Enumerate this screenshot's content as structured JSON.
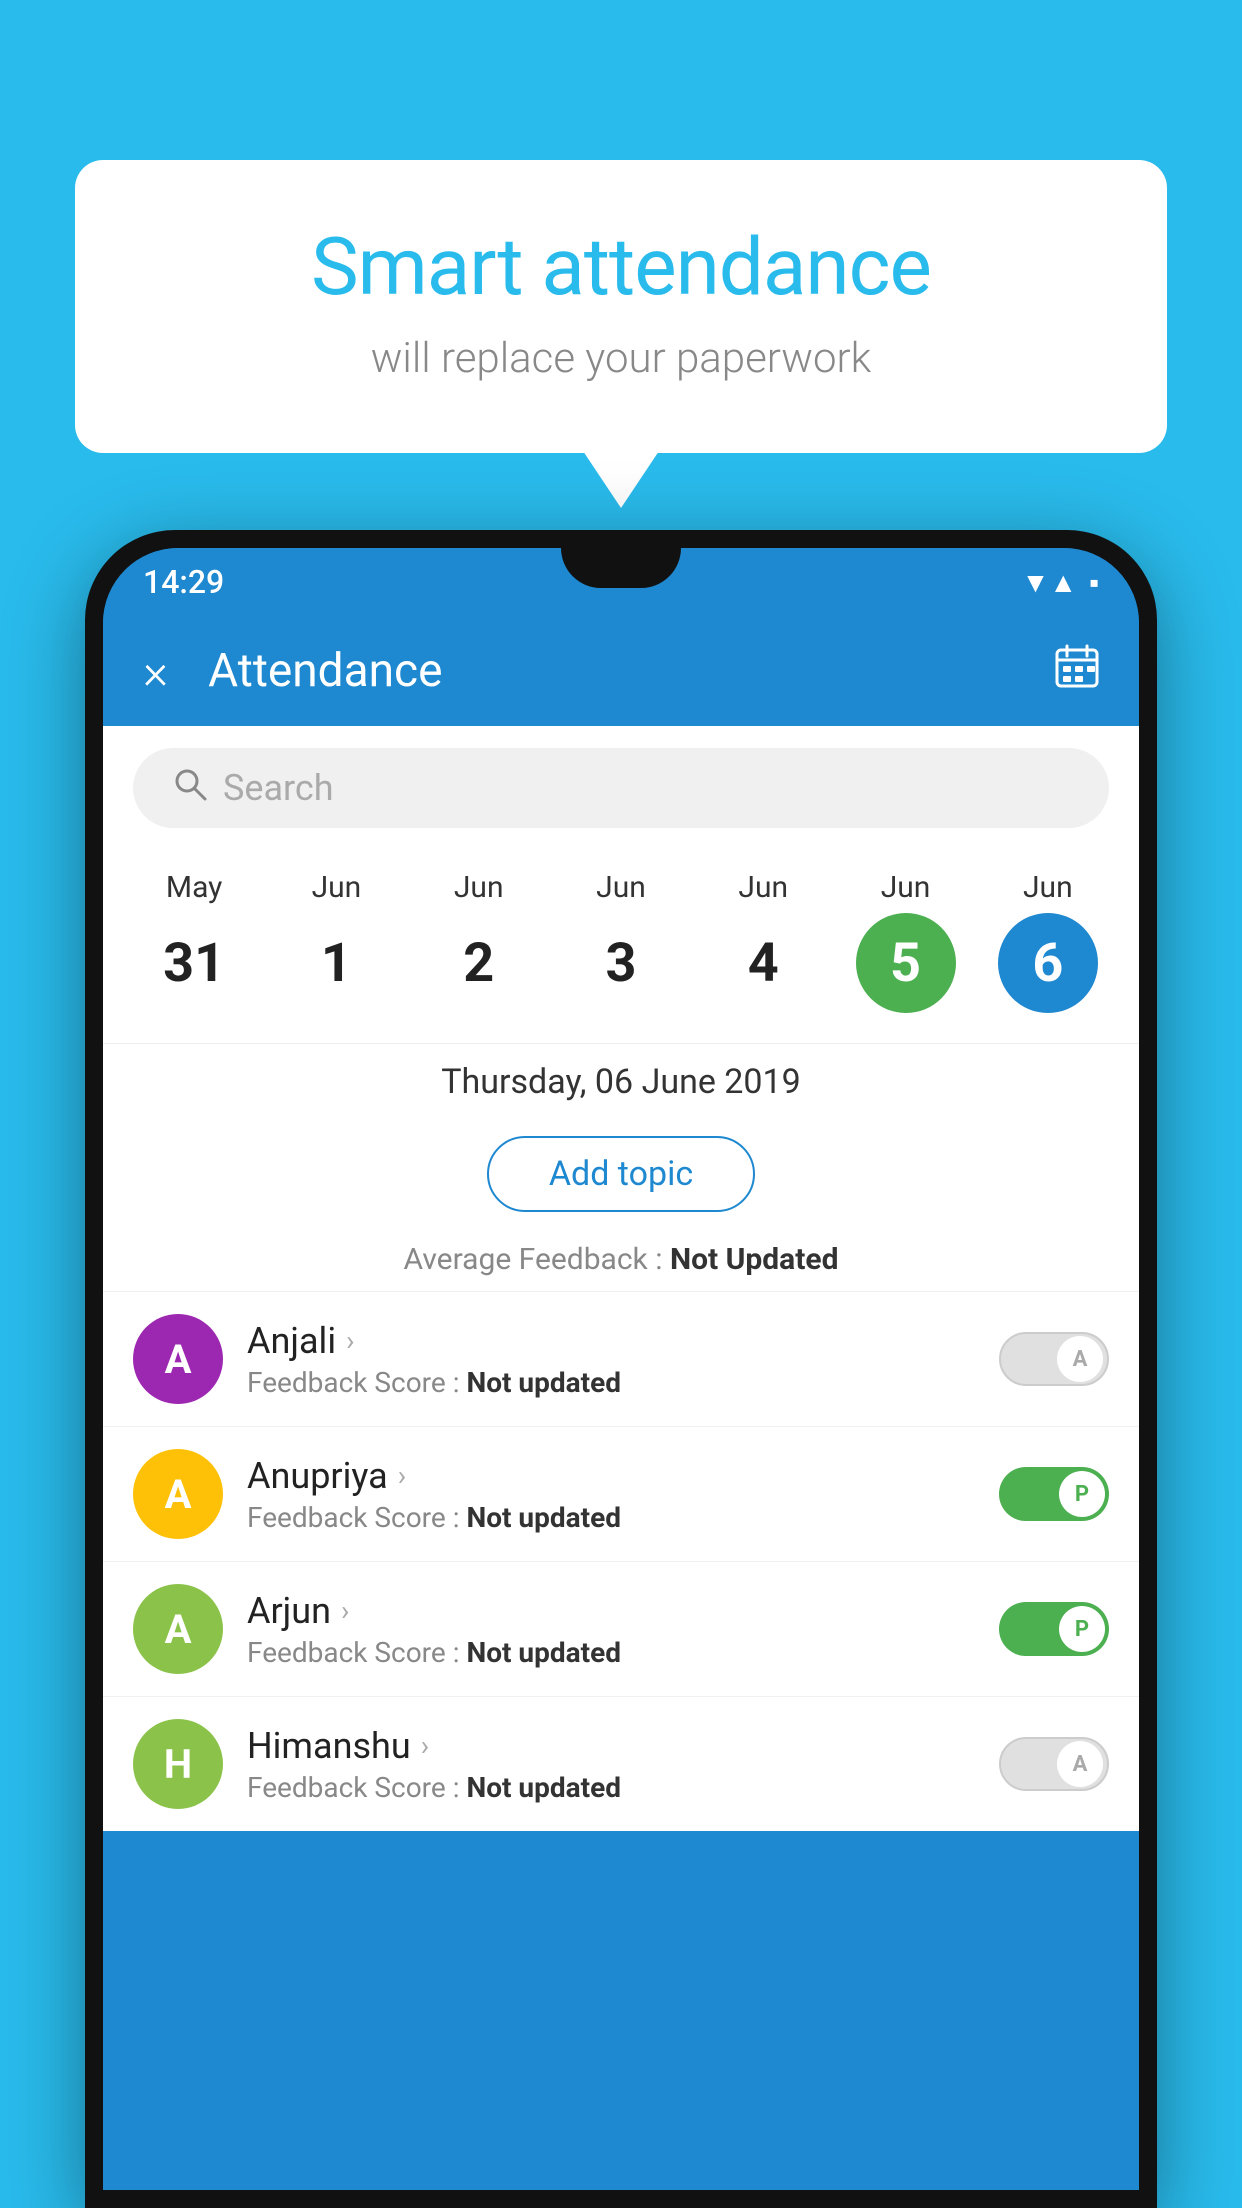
{
  "background_color": "#29BBEC",
  "speech_bubble": {
    "title": "Smart attendance",
    "subtitle": "will replace your paperwork"
  },
  "status_bar": {
    "time": "14:29",
    "icons": [
      "wifi",
      "signal",
      "battery"
    ]
  },
  "app_bar": {
    "title": "Attendance",
    "close_label": "×",
    "calendar_icon": "calendar"
  },
  "search": {
    "placeholder": "Search"
  },
  "calendar": {
    "dates": [
      {
        "month": "May",
        "day": "31",
        "active": false
      },
      {
        "month": "Jun",
        "day": "1",
        "active": false
      },
      {
        "month": "Jun",
        "day": "2",
        "active": false
      },
      {
        "month": "Jun",
        "day": "3",
        "active": false
      },
      {
        "month": "Jun",
        "day": "4",
        "active": false
      },
      {
        "month": "Jun",
        "day": "5",
        "active": "green"
      },
      {
        "month": "Jun",
        "day": "6",
        "active": "blue"
      }
    ]
  },
  "selected_date": "Thursday, 06 June 2019",
  "add_topic_label": "Add topic",
  "avg_feedback_label": "Average Feedback :",
  "avg_feedback_value": "Not Updated",
  "students": [
    {
      "name": "Anjali",
      "avatar_letter": "A",
      "avatar_color": "#9C27B0",
      "feedback_label": "Feedback Score :",
      "feedback_value": "Not updated",
      "toggle": "off",
      "toggle_letter": "A"
    },
    {
      "name": "Anupriya",
      "avatar_letter": "A",
      "avatar_color": "#FFC107",
      "feedback_label": "Feedback Score :",
      "feedback_value": "Not updated",
      "toggle": "on",
      "toggle_letter": "P"
    },
    {
      "name": "Arjun",
      "avatar_letter": "A",
      "avatar_color": "#8BC34A",
      "feedback_label": "Feedback Score :",
      "feedback_value": "Not updated",
      "toggle": "on",
      "toggle_letter": "P"
    },
    {
      "name": "Himanshu",
      "avatar_letter": "H",
      "avatar_color": "#8BC34A",
      "feedback_label": "Feedback Score :",
      "feedback_value": "Not updated",
      "toggle": "off",
      "toggle_letter": "A"
    }
  ]
}
